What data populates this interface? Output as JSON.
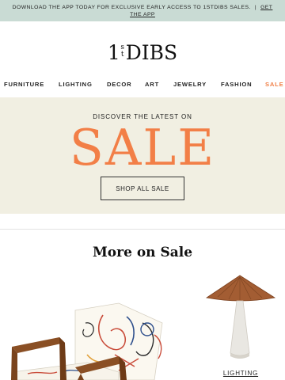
{
  "promo": {
    "text": "DOWNLOAD THE APP TODAY FOR EXCLUSIVE EARLY ACCESS TO 1STDIBS SALES.",
    "separator": "|",
    "link": "GET THE APP"
  },
  "logo": {
    "number": "1",
    "superscript": "st",
    "word": "DIBS"
  },
  "nav": {
    "items": [
      "FURNITURE",
      "LIGHTING",
      "DECOR",
      "ART",
      "JEWELRY",
      "FASHION",
      "SALE"
    ]
  },
  "hero": {
    "eyebrow": "DISCOVER THE LATEST ON",
    "title": "SALE",
    "button": "SHOP ALL SALE"
  },
  "section": {
    "title": "More on Sale"
  },
  "products": [
    {
      "image": "armchair-illustrated-image",
      "label": ""
    },
    {
      "image": "rattan-lamp-image",
      "label": "LIGHTING"
    }
  ],
  "colors": {
    "promo_background": "#c9dbd4",
    "hero_background": "#f1efe2",
    "accent": "#f27f47"
  }
}
